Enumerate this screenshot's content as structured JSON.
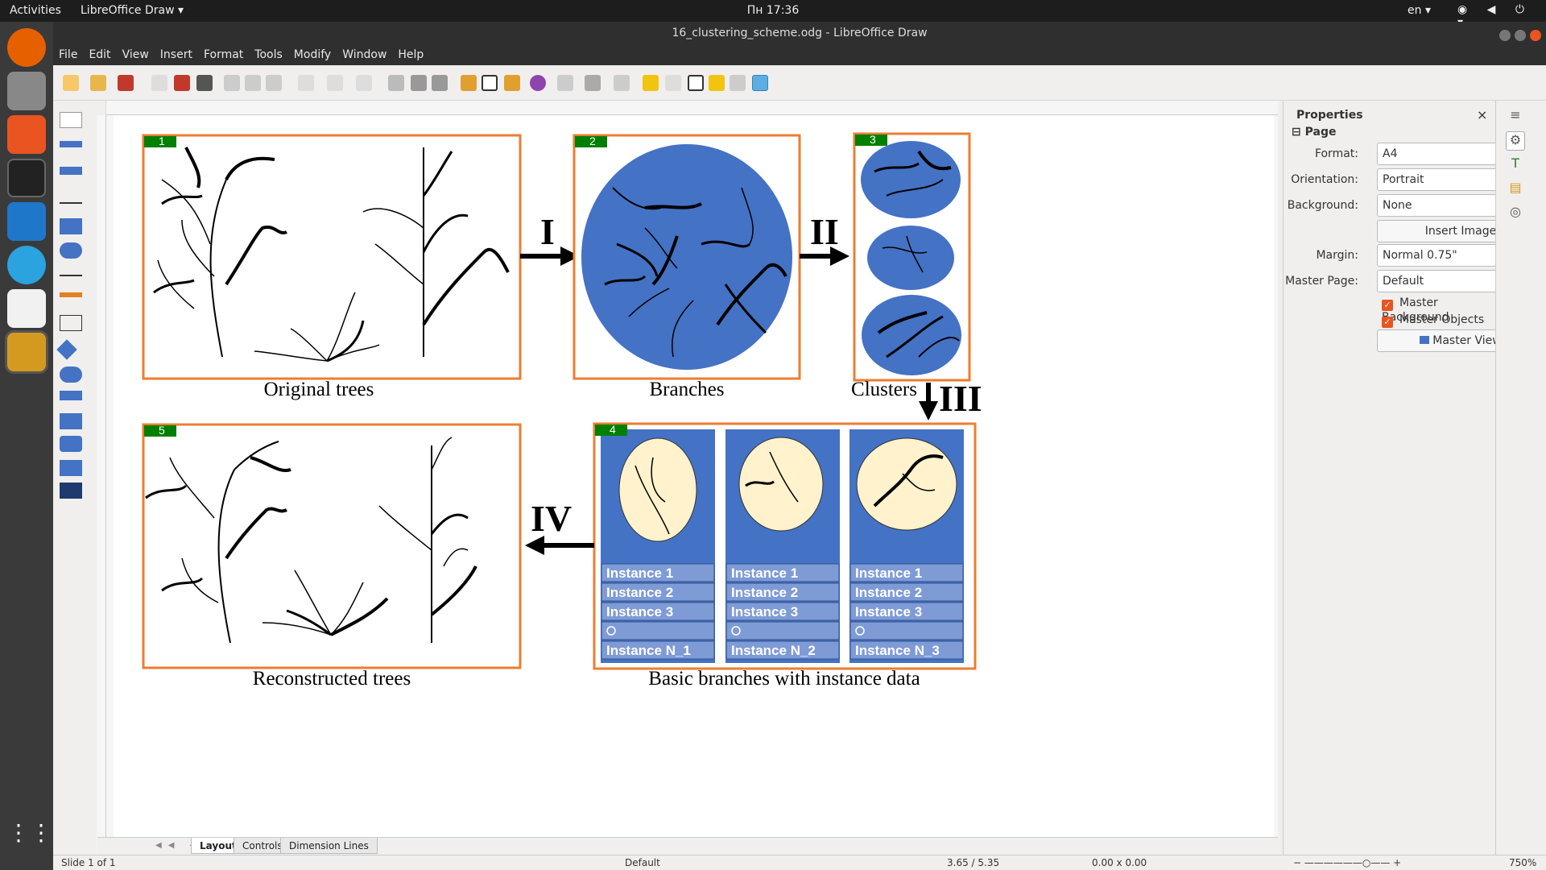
{
  "topbar": {
    "activities": "Activities",
    "app_name": "LibreOffice Draw",
    "clock": "Пн 17:36",
    "lang": "en"
  },
  "window": {
    "title": "16_clustering_scheme.odg - LibreOffice Draw"
  },
  "menu": [
    "File",
    "Edit",
    "View",
    "Insert",
    "Format",
    "Tools",
    "Modify",
    "Window",
    "Help"
  ],
  "diagram": {
    "panel_numbers": [
      "1",
      "2",
      "3",
      "4",
      "5"
    ],
    "captions": {
      "original": "Original trees",
      "branches": "Branches",
      "clusters": "Clusters",
      "basic": "Basic branches with instance data",
      "reconstructed": "Reconstructed trees"
    },
    "steps": [
      "I",
      "II",
      "III",
      "IV"
    ],
    "instance_lists": [
      [
        "Instance 1",
        "Instance 2",
        "Instance 3",
        "Instance N_1"
      ],
      [
        "Instance 1",
        "Instance 2",
        "Instance 3",
        "Instance N_2"
      ],
      [
        "Instance 1",
        "Instance 2",
        "Instance 3",
        "Instance N_3"
      ]
    ]
  },
  "tabs": [
    "Layout",
    "Controls",
    "Dimension Lines"
  ],
  "status": {
    "slide": "Slide 1 of 1",
    "master": "Default",
    "position": "3.65 / 5.35",
    "size": "0.00 x 0.00",
    "zoom": "750%"
  },
  "sidebar": {
    "title": "Properties",
    "section": "Page",
    "format_label": "Format:",
    "format_value": "A4",
    "orientation_label": "Orientation:",
    "orientation_value": "Portrait",
    "background_label": "Background:",
    "background_value": "None",
    "insert_image": "Insert Image",
    "margin_label": "Margin:",
    "margin_value": "Normal 0.75\"",
    "master_page_label": "Master Page:",
    "master_page_value": "Default",
    "master_background": "Master Background",
    "master_objects": "Master Objects",
    "master_view": "Master View"
  },
  "colors": {
    "accent": "#e95420",
    "panel_border": "#ed7d31",
    "number_tag": "#008000",
    "cluster_blue": "#4472c4",
    "cream": "#fff2cc"
  }
}
